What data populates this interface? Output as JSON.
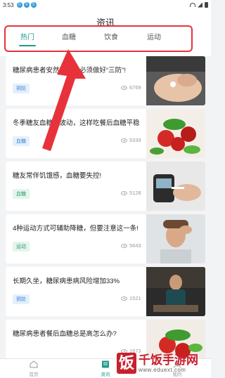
{
  "status": {
    "time": "3:53",
    "notif_icons": [
      "G",
      "S",
      "S"
    ]
  },
  "header": {
    "title": "资讯"
  },
  "tabs": [
    {
      "label": "热门",
      "active": true
    },
    {
      "label": "血糖",
      "active": false
    },
    {
      "label": "饮食",
      "active": false
    },
    {
      "label": "运动",
      "active": false
    }
  ],
  "articles": [
    {
      "title": "糖尿病患者安然过冬，必须做好“三防”!",
      "tag": "预防",
      "tag_color": "blue",
      "views": "6769",
      "thumb": "hand-pill-icon"
    },
    {
      "title": "冬季糖友血糖易波动，这样吃餐后血糖平稳",
      "tag": "血糖",
      "tag_color": "blue",
      "views": "5339",
      "thumb": "vegetables-icon"
    },
    {
      "title": "糖友常伴饥饿感，血糖要失控!",
      "tag": "血糖",
      "tag_color": "green",
      "views": "5128",
      "thumb": "glucose-meter-icon"
    },
    {
      "title": "4种运动方式可辅助降糖，但要注意这一条!",
      "tag": "运动",
      "tag_color": "green",
      "views": "5643",
      "thumb": "tired-man-icon"
    },
    {
      "title": "长期久坐，糖尿病患病风险增加33%",
      "tag": "预防",
      "tag_color": "blue",
      "views": "1521",
      "thumb": "sitting-man-icon"
    },
    {
      "title": "糖尿病患者餐后血糖总是高怎么办?",
      "tag": "",
      "tag_color": "blue",
      "views": "1673",
      "thumb": "vegetables-icon"
    }
  ],
  "bottom_nav": [
    {
      "label": "首页",
      "icon": "home-icon",
      "active": false
    },
    {
      "label": "资讯",
      "icon": "news-icon",
      "active": true
    },
    {
      "label": "我的",
      "icon": "profile-icon",
      "active": false
    }
  ],
  "watermark": {
    "logo": "饭",
    "name": "千饭手游网",
    "url": "www.eduext.com"
  },
  "colors": {
    "accent": "#1f9b8a",
    "highlight": "#e8323b",
    "watermark": "#c8202e"
  }
}
